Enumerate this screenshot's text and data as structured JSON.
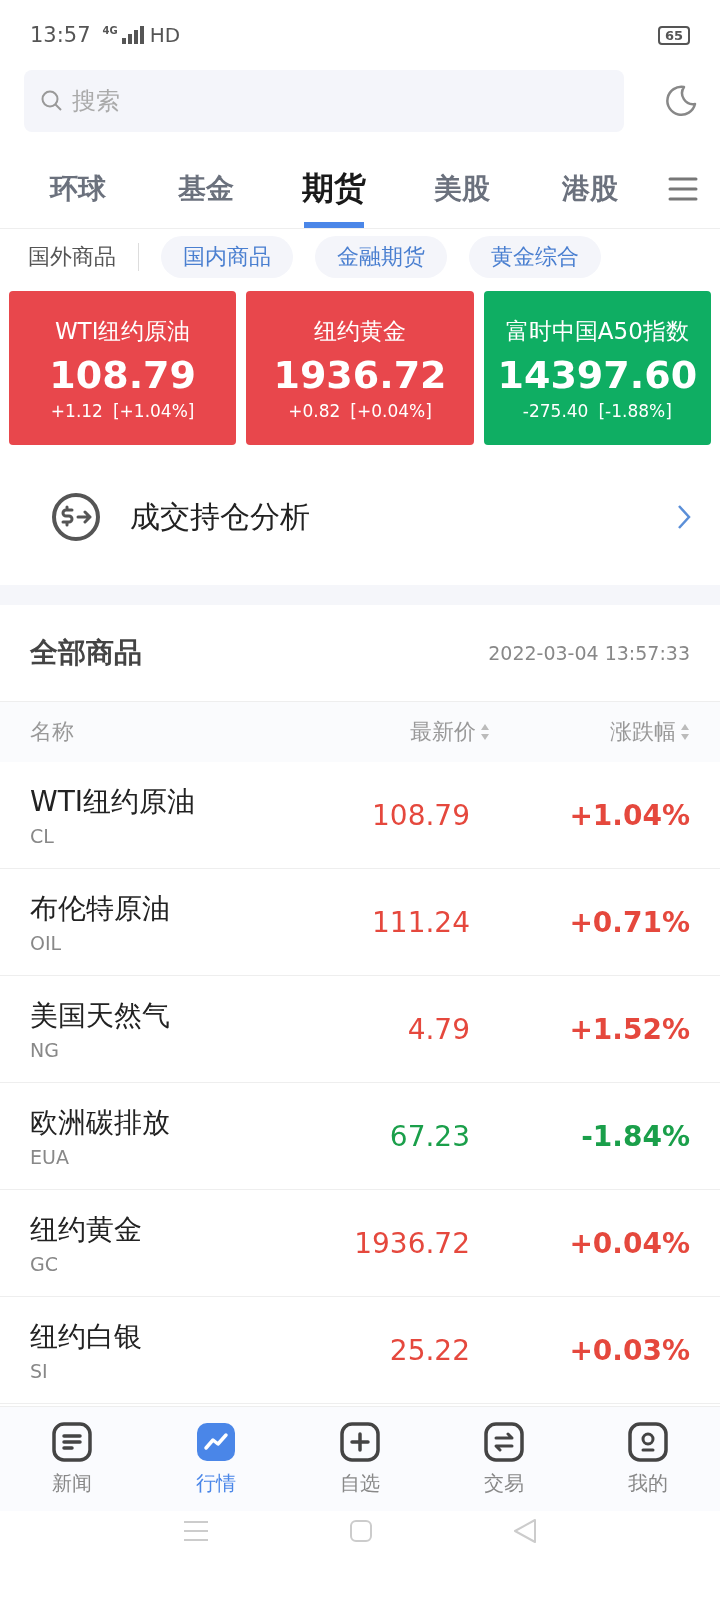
{
  "status_bar": {
    "time": "13:57",
    "network": "4G",
    "hd": "HD",
    "battery": "65"
  },
  "search": {
    "placeholder": "搜索"
  },
  "tabs": [
    {
      "label": "环球",
      "selected": false
    },
    {
      "label": "基金",
      "selected": false
    },
    {
      "label": "期货",
      "selected": true
    },
    {
      "label": "美股",
      "selected": false
    },
    {
      "label": "港股",
      "selected": false
    }
  ],
  "categories": [
    {
      "label": "国外商品",
      "selected": true
    },
    {
      "label": "国内商品",
      "selected": false
    },
    {
      "label": "金融期货",
      "selected": false
    },
    {
      "label": "黄金综合",
      "selected": false
    }
  ],
  "cards": [
    {
      "name": "WTI纽约原油",
      "price": "108.79",
      "change": "+1.12",
      "percent": "[+1.04%]",
      "color": "#e8474c"
    },
    {
      "name": "纽约黄金",
      "price": "1936.72",
      "change": "+0.82",
      "percent": "[+0.04%]",
      "color": "#e8474c"
    },
    {
      "name": "富时中国A50指数",
      "price": "14397.60",
      "change": "-275.40",
      "percent": "[-1.88%]",
      "color": "#0fae63"
    }
  ],
  "analysis": {
    "label": "成交持仓分析"
  },
  "list": {
    "title": "全部商品",
    "timestamp": "2022-03-04 13:57:33",
    "columns": [
      "名称",
      "最新价",
      "涨跌幅"
    ],
    "rows": [
      {
        "name": "WTI纽约原油",
        "code": "CL",
        "price": "108.79",
        "change": "+1.04%",
        "color": "#e5483d"
      },
      {
        "name": "布伦特原油",
        "code": "OIL",
        "price": "111.24",
        "change": "+0.71%",
        "color": "#e5483d"
      },
      {
        "name": "美国天然气",
        "code": "NG",
        "price": "4.79",
        "change": "+1.52%",
        "color": "#e5483d"
      },
      {
        "name": "欧洲碳排放",
        "code": "EUA",
        "price": "67.23",
        "change": "-1.84%",
        "color": "#1a9f4a"
      },
      {
        "name": "纽约黄金",
        "code": "GC",
        "price": "1936.72",
        "change": "+0.04%",
        "color": "#e5483d"
      },
      {
        "name": "纽约白银",
        "code": "SI",
        "price": "25.22",
        "change": "+0.03%",
        "color": "#e5483d"
      }
    ]
  },
  "bottom_nav": [
    {
      "label": "新闻",
      "selected": false,
      "kind": "news"
    },
    {
      "label": "行情",
      "selected": true,
      "kind": "market"
    },
    {
      "label": "自选",
      "selected": false,
      "kind": "watchlist"
    },
    {
      "label": "交易",
      "selected": false,
      "kind": "trade"
    },
    {
      "label": "我的",
      "selected": false,
      "kind": "profile"
    }
  ]
}
